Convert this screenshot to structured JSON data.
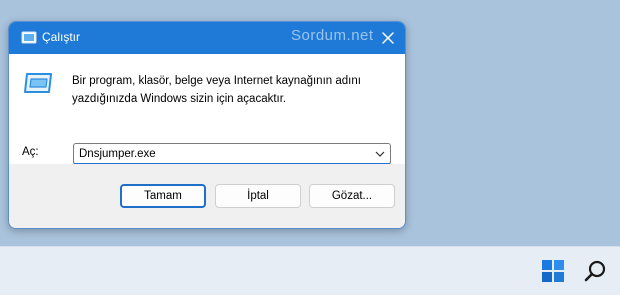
{
  "dialog": {
    "title": "Çalıştır",
    "watermark": "Sordum.net",
    "description": "Bir program, klasör, belge veya Internet kaynağının adını yazdığınızda Windows sizin için açacaktır.",
    "open_label": "Aç:",
    "open_value": "Dnsjumper.exe",
    "buttons": {
      "ok": "Tamam",
      "cancel": "İptal",
      "browse": "Gözat..."
    }
  },
  "taskbar": {
    "icons": [
      "windows-start-icon",
      "search-icon"
    ]
  },
  "colors": {
    "titlebar": "#1e7ad6",
    "desktop": "#a9c3dc",
    "taskbar": "#e6edf5",
    "accent": "#1f6fc9"
  }
}
